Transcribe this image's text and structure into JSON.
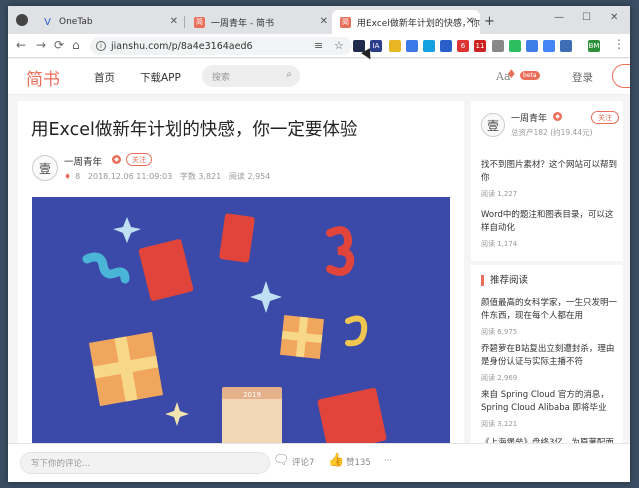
{
  "browser": {
    "tabs": [
      {
        "title": "OneTab"
      },
      {
        "title": "一周青年 - 简书"
      },
      {
        "title": "用Excel做新年计划的快感，你一..."
      }
    ],
    "new_tab_glyph": "+",
    "url": "jianshu.com/p/8a4e3164aed6",
    "win_controls": {
      "minimize": "—",
      "maximize": "☐",
      "close": "✕"
    },
    "nav": {
      "back": "←",
      "forward": "→",
      "reload": "⟳",
      "home": "⌂"
    },
    "ext_badges": [
      "6",
      "11"
    ],
    "ext_labels": [
      "IA",
      "BM"
    ]
  },
  "site": {
    "logo": "简书",
    "nav_home": "首页",
    "nav_app": "下载APP",
    "search_placeholder": "搜索",
    "font_toggle": "Aa",
    "beta": "beta",
    "login": "登录"
  },
  "article": {
    "title": "用Excel做新年计划的快感，你一定要体验",
    "author": "一周青年",
    "avatar_char": "壹",
    "follow": "关注",
    "diamond": "8",
    "date": "2018.12.06 11:09:03",
    "words": "字数 3,821",
    "reads": "阅读 2,954",
    "calendar_label": "2019"
  },
  "sidebar": {
    "author_name": "一周青年",
    "author_follow": "关注",
    "assets": "总资产182 (约19.44元)",
    "author_posts": [
      {
        "title": "找不到图片素材？这个网站可以帮到你",
        "reads": "阅读 1,227"
      },
      {
        "title": "Word中的题注和图表目录，可以这样自动化",
        "reads": "阅读 1,174"
      }
    ],
    "recommend_title": "推荐阅读",
    "recommend": [
      {
        "title": "颜值最高的女科学家，一生只发明一件东西，现在每个人都在用",
        "reads": "阅读 6,975"
      },
      {
        "title": "乔碧萝在B站复出立刻遭封杀，理由是身份认证与实际主播不符",
        "reads": "阅读 2,969"
      },
      {
        "title": "来自 Spring Cloud 官方的消息，Spring Cloud Alibaba 即将毕业",
        "reads": "阅读 3,121"
      },
      {
        "title": "《上海堡垒》盘终3亿，为原著配面",
        "reads": ""
      }
    ]
  },
  "bottom": {
    "comment_placeholder": "写下你的评论...",
    "comments": "评论7",
    "likes": "赞135",
    "more": "···"
  },
  "colors": {
    "brand": "#ea6f5a",
    "hero_bg": "#3b49a8"
  }
}
